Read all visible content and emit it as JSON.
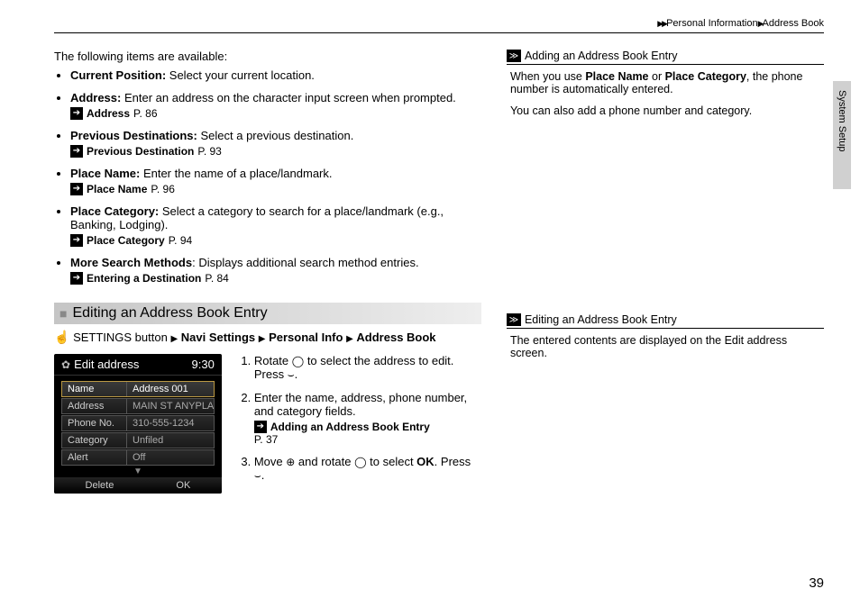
{
  "breadcrumb": {
    "a": "Personal Information",
    "b": "Address Book"
  },
  "side_tab": "System Setup",
  "intro": "The following items are available:",
  "items": [
    {
      "title": "Current Position:",
      "desc": " Select your current location.",
      "ref": null
    },
    {
      "title": "Address:",
      "desc": " Enter an address on the character input screen when prompted.",
      "ref": {
        "label": "Address",
        "page": "P. 86"
      }
    },
    {
      "title": "Previous Destinations:",
      "desc": " Select a previous destination.",
      "ref": {
        "label": "Previous Destination",
        "page": "P. 93"
      }
    },
    {
      "title": "Place Name:",
      "desc": " Enter the name of a place/landmark.",
      "ref": {
        "label": "Place Name",
        "page": "P. 96"
      }
    },
    {
      "title": "Place Category:",
      "desc": " Select a category to search for a place/landmark (e.g., Banking, Lodging).",
      "ref": {
        "label": "Place Category",
        "page": "P. 94"
      }
    },
    {
      "title": "More Search Methods",
      "desc": ": Displays additional search method entries.",
      "ref": {
        "label": "Entering a Destination",
        "page": "P. 84"
      }
    }
  ],
  "section_heading": "Editing an Address Book Entry",
  "nav_path": {
    "prefix": "SETTINGS button",
    "parts": [
      "Navi Settings",
      "Personal Info",
      "Address Book"
    ]
  },
  "screenshot": {
    "title": "Edit address",
    "time": "9:30",
    "rows": [
      {
        "label": "Name",
        "value": "Address 001",
        "selected": true
      },
      {
        "label": "Address",
        "value": "MAIN ST ANYPLACE, CALIFO",
        "selected": false
      },
      {
        "label": "Phone No.",
        "value": "310-555-1234",
        "selected": false
      },
      {
        "label": "Category",
        "value": "Unfiled",
        "selected": false
      },
      {
        "label": "Alert",
        "value": "Off",
        "selected": false
      }
    ],
    "footer": {
      "left": "Delete",
      "right": "OK"
    }
  },
  "steps": {
    "s1a": "Rotate ",
    "s1b": " to select the address to edit. Press ",
    "s1c": ".",
    "s2": "Enter the name, address, phone number, and category fields.",
    "s2ref_label": "Adding an Address Book Entry",
    "s2ref_page": "P. 37",
    "s3a": "Move ",
    "s3b": " and rotate ",
    "s3c": " to select ",
    "s3ok": "OK",
    "s3d": ". Press ",
    "s3e": "."
  },
  "notes": {
    "n1_title": "Adding an Address Book Entry",
    "n1_p1a": "When you use ",
    "n1_b1": "Place Name",
    "n1_p1b": " or ",
    "n1_b2": "Place Category",
    "n1_p1c": ", the phone number is automatically entered.",
    "n1_p2": "You can also add a phone number and category.",
    "n2_title": "Editing an Address Book Entry",
    "n2_p1": "The entered contents are displayed on the Edit address screen."
  },
  "page_number": "39"
}
